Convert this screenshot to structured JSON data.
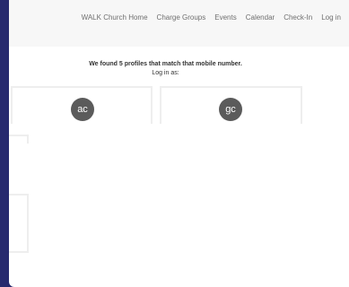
{
  "nav": {
    "items": [
      "WALK Church Home",
      "Charge Groups",
      "Events",
      "Calendar",
      "Check-In",
      "Log in"
    ]
  },
  "message": {
    "heading": "We found 5 profiles that match that mobile number.",
    "subheading": "Log in as:"
  },
  "profiles": [
    {
      "initials": "ac"
    },
    {
      "initials": "gc"
    }
  ]
}
